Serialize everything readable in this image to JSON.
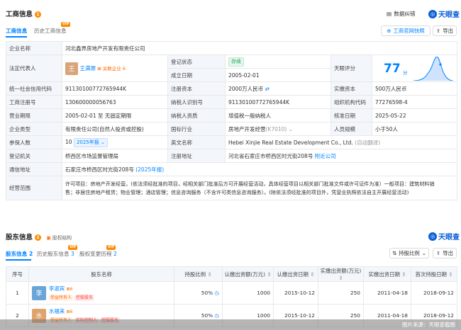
{
  "section1": {
    "title": "工商信息",
    "badge": "1",
    "tabs": [
      {
        "label": "工商信息"
      },
      {
        "label": "历史工商信息",
        "vip": "VIP"
      }
    ],
    "dispute_label": "数据纠错",
    "brand": "天眼查",
    "official_btn": "工商官网快照",
    "export_btn": "导出"
  },
  "info": {
    "company_name_label": "企业名称",
    "company_name": "河北鑫界房地产开发有限责任公司",
    "legal_rep_label": "法定代表人",
    "legal_rep_avatar": "王",
    "legal_rep_name": "王满塬",
    "related_label": "关联企业 6",
    "reg_status_label": "登记状态",
    "reg_status": "存续",
    "found_date_label": "成立日期",
    "found_date": "2005-02-01",
    "score_label": "天眼评分",
    "score": "77",
    "score_unit": "分",
    "credit_code_label": "统一社会信用代码",
    "credit_code": "91130100772765944K",
    "reg_capital_label": "注册资本",
    "reg_capital": "2000万人民币",
    "paid_capital_label": "实缴资本",
    "paid_capital": "500万人民币",
    "reg_no_label": "工商注册号",
    "reg_no": "130600000056763",
    "taxpayer_no_label": "纳税人识别号",
    "taxpayer_no": "91130100772765944K",
    "org_code_label": "组织机构代码",
    "org_code": "77276598-4",
    "period_label": "营业期限",
    "period": "2005-02-01 至 无固定期限",
    "taxpayer_qual_label": "纳税人资质",
    "taxpayer_qual": "增值税一般纳税人",
    "approve_date_label": "核准日期",
    "approve_date": "2025-05-22",
    "type_label": "企业类型",
    "type": "有限责任公司(自然人投资或控股)",
    "industry_label": "国标行业",
    "industry": "房地产开发经营",
    "industry_code": "(K7010)",
    "staff_label": "人员规模",
    "staff": "小于50人",
    "insured_label": "参保人数",
    "insured": "10",
    "insured_year": "2025年报",
    "en_name_label": "英文名称",
    "en_name": "Hebei Xinjie Real Estate Development Co., Ltd.",
    "en_name_note": "(自动翻译)",
    "authority_label": "登记机关",
    "authority": "桥西区市场监督管理局",
    "reg_addr_label": "注册地址",
    "reg_addr": "河北省石家庄市桥西区时光街208号",
    "nearby": "附近公司",
    "mail_addr_label": "通信地址",
    "mail_addr": "石家庄市桥西区时光街208号",
    "mail_addr_year": "(2025年报)",
    "scope_label": "经营范围",
    "scope_line1": "许可项目：房地产开发经营。(依法须经批准的项目，经相关部门批准后方可开展经营活动，具体经营项目以相关部门批准文件或许可证件为准）一般项目：建筑材料销",
    "scope_line2": "售；非居住房地产租赁；物业管理；酒店管理；信息咨询服务（不含许可类信息咨询服务）。(除依法须经批准的项目外，凭营业执照依法自主开展经营活动)"
  },
  "section2": {
    "title": "股东信息",
    "badge": "2",
    "equity_label": "股权结构",
    "brand": "天眼查",
    "tabs": [
      {
        "label": "股东信息",
        "count": "2"
      },
      {
        "label": "历史股东信息",
        "count": "3",
        "vip": "VIP"
      },
      {
        "label": "股权变更历程",
        "count": "2",
        "vip": "VIP"
      }
    ],
    "sort_btn": "持股比例",
    "export_btn": "导出",
    "columns": [
      "序号",
      "股东名称",
      "持股比例",
      "认缴出资额(万元)",
      "认缴出资日期",
      "实缴出资额(万元)",
      "实缴出资日期",
      "首次持股日期"
    ],
    "rows": [
      {
        "idx": "1",
        "avatar": "李",
        "name": "李淑宾",
        "count": "6",
        "chips": [
          "受益所有人",
          "控股股东"
        ],
        "ratio": "50%",
        "subscribed": "1000",
        "sub_date": "2015-10-12",
        "paid": "250",
        "paid_date": "2011-04-18",
        "first_date": "2018-09-12"
      },
      {
        "idx": "2",
        "avatar": "水",
        "name": "水福来",
        "count": "6",
        "chips": [
          "受益所有人",
          "实际控制人",
          "控股股东"
        ],
        "ratio": "50%",
        "subscribed": "1000",
        "sub_date": "2015-10-12",
        "paid": "250",
        "paid_date": "2011-04-18",
        "first_date": "2018-09-12"
      }
    ]
  },
  "watermark": "图片来源：天眼查截图",
  "colors": {
    "accent": "#0084ff",
    "badge": "#ff8a00",
    "brand": "#0a5fd6"
  }
}
